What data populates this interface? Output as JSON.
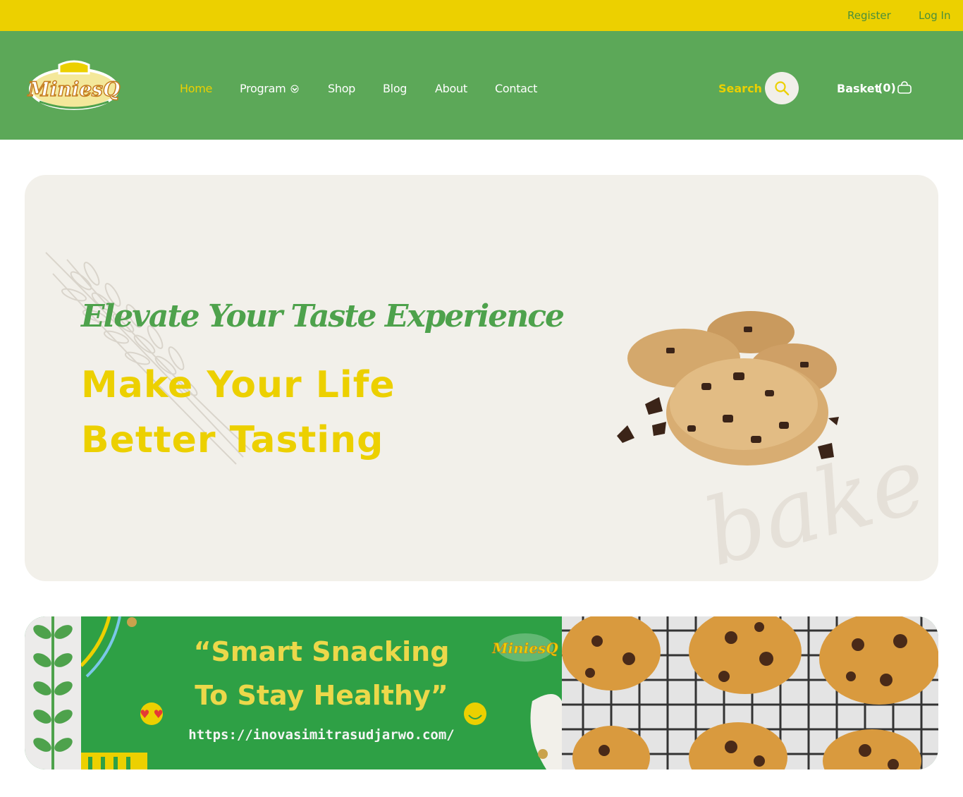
{
  "topbar": {
    "register_label": "Register",
    "login_label": "Log In"
  },
  "header": {
    "logo_text": "MiniesQ",
    "nav": [
      "Home",
      "Program",
      "Shop",
      "Blog",
      "About",
      "Contact"
    ],
    "search_label": "Search",
    "basket_label": "Basket",
    "basket_count": "(0)"
  },
  "hero": {
    "script_heading": "Elevate Your Taste Experience",
    "title_line1": "Make Your Life",
    "title_line2": "Better Tasting",
    "watermark_text": "baked with love"
  },
  "banner": {
    "line1": "“Smart Snacking",
    "line2": "To Stay Healthy”",
    "url": "https://inovasimitrasudjarwo.com/",
    "logo_text": "MiniesQ"
  },
  "colors": {
    "brand_green": "#5ca858",
    "brand_yellow": "#ecd000",
    "hero_bg": "#f2f0ea",
    "banner_green": "#2ea045"
  }
}
